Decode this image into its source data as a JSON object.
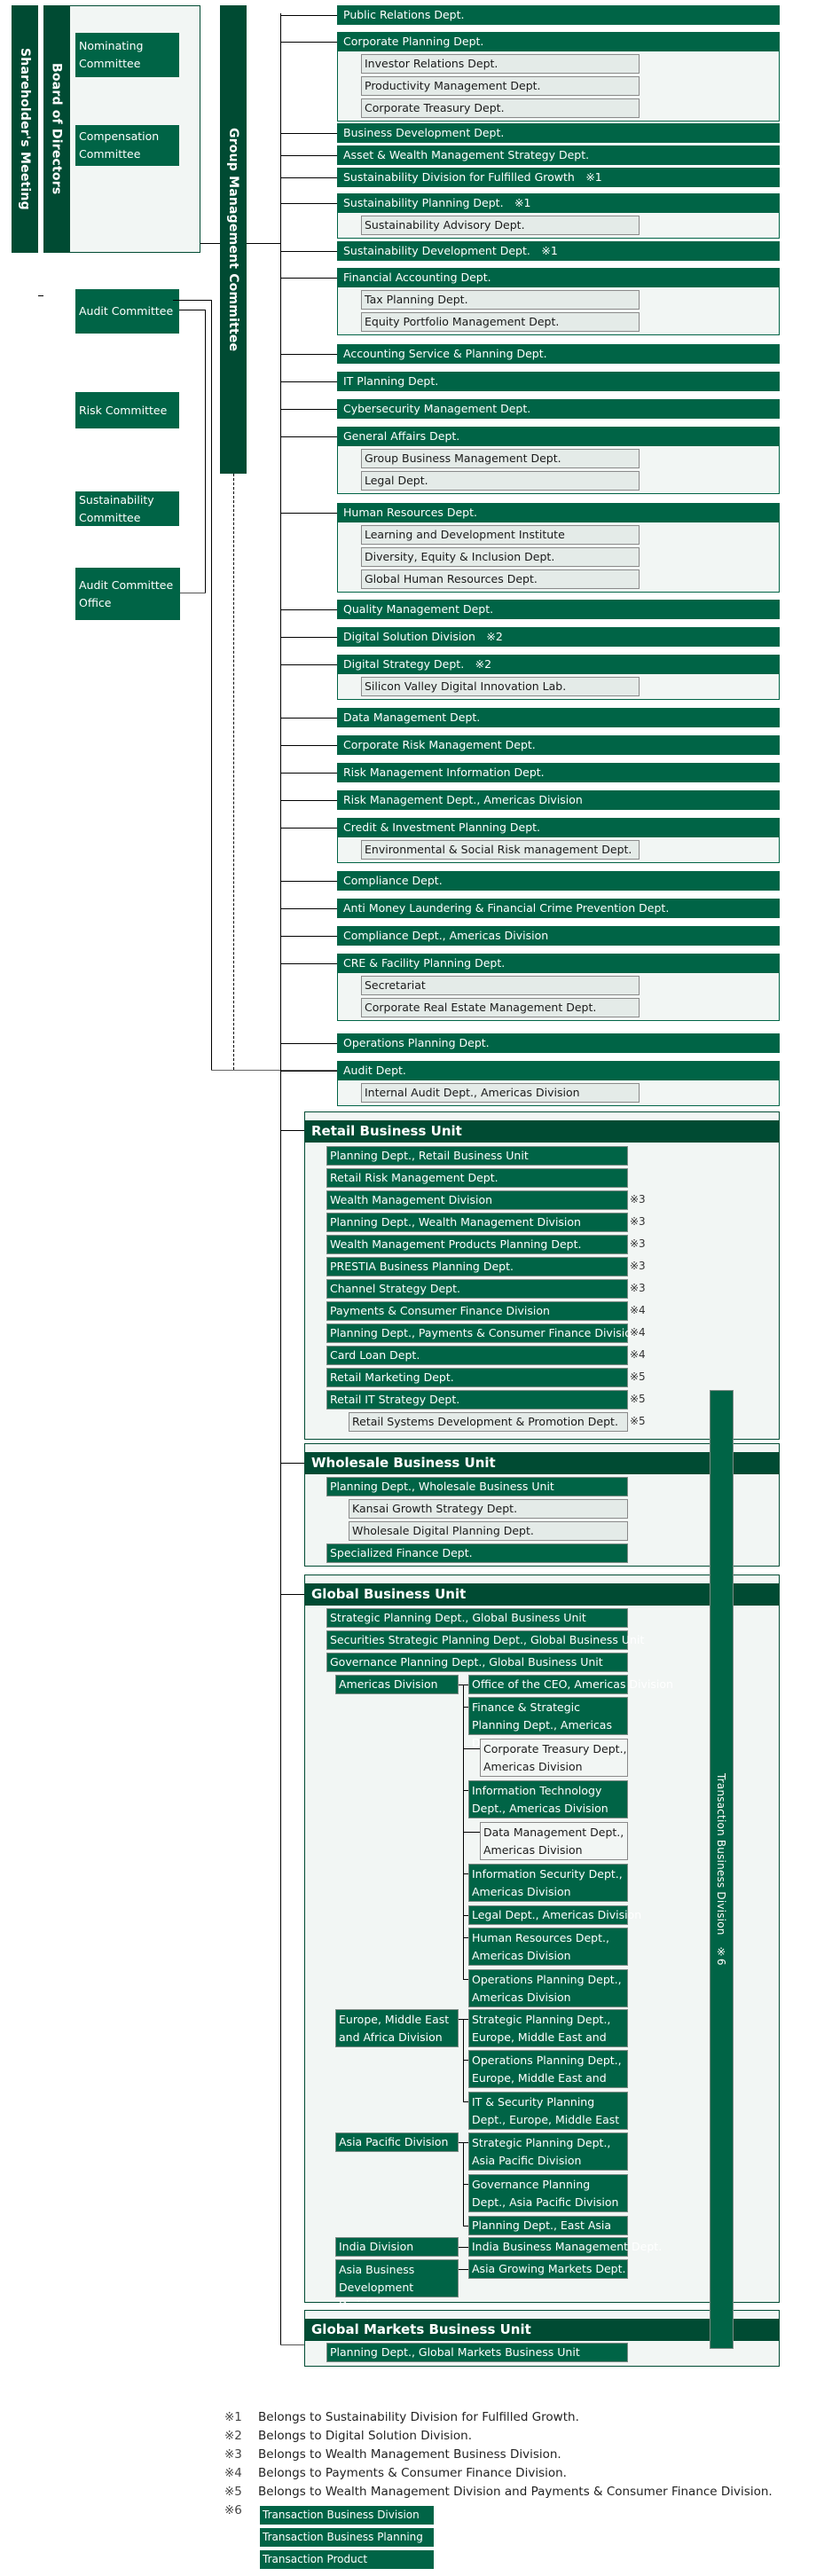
{
  "governance": {
    "shareholders_meeting": "Shareholder's Meeting",
    "board_of_directors": "Board of Directors",
    "group_management_committee": "Group Management Committee",
    "committees": [
      {
        "line1": "Nominating",
        "line2": "Committee"
      },
      {
        "line1": "Compensation",
        "line2": "Committee"
      },
      {
        "line1": "Audit Committee",
        "line2": ""
      },
      {
        "line1": "Risk Committee",
        "line2": ""
      },
      {
        "line1": "Sustainability",
        "line2": "Committee"
      }
    ],
    "audit_committee_office": {
      "line1": "Audit Committee",
      "line2": "Office"
    }
  },
  "corporate_depts": [
    {
      "name": "Public Relations Dept.",
      "subs": []
    },
    {
      "name": "Corporate Planning Dept.",
      "subs": [
        "Investor Relations Dept.",
        "Productivity Management Dept.",
        "Corporate Treasury Dept."
      ]
    },
    {
      "name": "Business Development Dept.",
      "subs": []
    },
    {
      "name": "Asset & Wealth Management Strategy Dept.",
      "subs": []
    },
    {
      "name": "Sustainability Division for Fulfilled Growth　※1",
      "subs": []
    },
    {
      "name": "Sustainability Planning Dept.　※1",
      "subs": [
        "Sustainability Advisory Dept."
      ]
    },
    {
      "name": "Sustainability Development Dept.　※1",
      "subs": []
    },
    {
      "name": "Financial Accounting Dept.",
      "subs": [
        "Tax Planning Dept.",
        "Equity Portfolio Management Dept."
      ]
    },
    {
      "name": "Accounting Service & Planning Dept.",
      "subs": []
    },
    {
      "name": "IT Planning Dept.",
      "subs": []
    },
    {
      "name": "Cybersecurity Management Dept.",
      "subs": []
    },
    {
      "name": "General Affairs Dept.",
      "subs": [
        "Group Business Management Dept.",
        "Legal Dept."
      ]
    },
    {
      "name": "Human Resources Dept.",
      "subs": [
        "Learning and Development Institute",
        "Diversity, Equity & Inclusion Dept.",
        "Global Human Resources Dept."
      ]
    },
    {
      "name": "Quality Management Dept.",
      "subs": []
    },
    {
      "name": "Digital Solution Division　※2",
      "subs": []
    },
    {
      "name": "Digital Strategy Dept.　※2",
      "subs": [
        "Silicon Valley Digital Innovation Lab."
      ]
    },
    {
      "name": "Data Management Dept.",
      "subs": []
    },
    {
      "name": "Corporate Risk Management Dept.",
      "subs": []
    },
    {
      "name": "Risk Management Information Dept.",
      "subs": []
    },
    {
      "name": "Risk Management Dept., Americas Division",
      "subs": []
    },
    {
      "name": "Credit & Investment Planning Dept.",
      "subs": [
        "Environmental & Social Risk management Dept."
      ]
    },
    {
      "name": "Compliance Dept.",
      "subs": []
    },
    {
      "name": "Anti Money Laundering & Financial Crime Prevention Dept.",
      "subs": []
    },
    {
      "name": "Compliance Dept., Americas Division",
      "subs": []
    },
    {
      "name": "CRE & Facility Planning Dept.",
      "subs": [
        "Secretariat",
        "Corporate Real Estate Management Dept."
      ]
    },
    {
      "name": "Operations Planning Dept.",
      "subs": []
    },
    {
      "name": "Audit Dept.",
      "subs": [
        "Internal Audit Dept., Americas Division"
      ]
    }
  ],
  "retail_unit": {
    "title": "Retail Business Unit",
    "items": [
      {
        "name": "Planning Dept., Retail Business Unit",
        "note": "",
        "sub": false
      },
      {
        "name": "Retail Risk Management Dept.",
        "note": "",
        "sub": false
      },
      {
        "name": "Wealth Management Division",
        "note": "※3",
        "sub": false
      },
      {
        "name": "Planning Dept., Wealth Management Division",
        "note": "※3",
        "sub": false
      },
      {
        "name": "Wealth Management Products Planning Dept.",
        "note": "※3",
        "sub": false
      },
      {
        "name": "PRESTIA Business Planning Dept.",
        "note": "※3",
        "sub": false
      },
      {
        "name": "Channel Strategy Dept.",
        "note": "※3",
        "sub": false
      },
      {
        "name": "Payments & Consumer Finance Division",
        "note": "※4",
        "sub": false
      },
      {
        "name": "Planning Dept., Payments & Consumer Finance Division",
        "note": "※4",
        "sub": false
      },
      {
        "name": "Card Loan Dept.",
        "note": "※4",
        "sub": false
      },
      {
        "name": "Retail Marketing Dept.",
        "note": "※5",
        "sub": false
      },
      {
        "name": "Retail IT Strategy Dept.",
        "note": "※5",
        "sub": false
      },
      {
        "name": "Retail Systems Development & Promotion Dept.",
        "note": "※5",
        "sub": true
      }
    ]
  },
  "wholesale_unit": {
    "title": "Wholesale Business Unit",
    "items": [
      {
        "name": "Planning Dept., Wholesale Business Unit",
        "sub": false
      },
      {
        "name": "Kansai Growth Strategy Dept.",
        "sub": true
      },
      {
        "name": "Wholesale Digital Planning Dept.",
        "sub": true
      },
      {
        "name": "Specialized Finance Dept.",
        "sub": false
      }
    ]
  },
  "global_unit": {
    "title": "Global Business Unit",
    "top_items": [
      "Strategic Planning Dept., Global Business Unit",
      "Securities Strategic Planning Dept., Global Business Unit",
      "Governance Planning Dept., Global Business Unit"
    ],
    "divisions": [
      {
        "name": "Americas Division",
        "depts": [
          {
            "name": "Office of the CEO, Americas Division",
            "light": false
          },
          {
            "name": "Finance & Strategic Planning Dept., Americas Division",
            "light": false
          },
          {
            "name": "Corporate Treasury Dept., Americas Division",
            "light": true
          },
          {
            "name": "Information Technology Dept., Americas Division",
            "light": false
          },
          {
            "name": "Data Management Dept., Americas Division",
            "light": true
          },
          {
            "name": "Information Security Dept., Americas Division",
            "light": false
          },
          {
            "name": "Legal Dept., Americas Division",
            "light": false
          },
          {
            "name": "Human Resources Dept., Americas Division",
            "light": false
          },
          {
            "name": "Operations Planning Dept., Americas Division",
            "light": false
          }
        ]
      },
      {
        "name": "Europe, Middle East and Africa Division",
        "depts": [
          {
            "name": "Strategic Planning Dept., Europe, Middle East and Africa Division",
            "light": false
          },
          {
            "name": "Operations Planning Dept., Europe, Middle East and Africa Division",
            "light": false
          },
          {
            "name": "IT & Security Planning Dept., Europe, Middle East and Africa Division",
            "light": false
          }
        ]
      },
      {
        "name": "Asia Pacific Division",
        "depts": [
          {
            "name": "Strategic Planning Dept., Asia Pacific Division",
            "light": false
          },
          {
            "name": "Governance Planning Dept., Asia Pacific Division",
            "light": false
          },
          {
            "name": "Planning Dept., East Asia",
            "light": false
          }
        ]
      },
      {
        "name": "India Division",
        "depts": [
          {
            "name": "India Business Management Dept.",
            "light": false
          }
        ]
      },
      {
        "name": "Asia Business Development Division",
        "depts": [
          {
            "name": "Asia Growing Markets Dept.",
            "light": false
          }
        ]
      }
    ]
  },
  "global_markets_unit": {
    "title": "Global Markets Business Unit",
    "items": [
      "Planning Dept., Global Markets Business Unit"
    ]
  },
  "transaction_division_bar": "Transaction Business Division　※6",
  "notes": [
    {
      "mark": "※1",
      "text": "Belongs to Sustainability Division for Fulfilled Growth."
    },
    {
      "mark": "※2",
      "text": "Belongs to Digital Solution Division."
    },
    {
      "mark": "※3",
      "text": "Belongs to Wealth Management Business Division."
    },
    {
      "mark": "※4",
      "text": "Belongs to Payments & Consumer Finance Division."
    },
    {
      "mark": "※5",
      "text": "Belongs to Wealth Management Division and Payments & Consumer Finance Division."
    },
    {
      "mark": "※6",
      "text": ""
    }
  ],
  "note6_boxes": [
    "Transaction Business Division",
    "Transaction Business Planning Dept.",
    "Transaction Product Development Dept."
  ],
  "colors": {
    "dark_green": "#004b33",
    "green": "#006446",
    "panel": "#f2f6f4",
    "sub_box": "#e4ebe8"
  }
}
